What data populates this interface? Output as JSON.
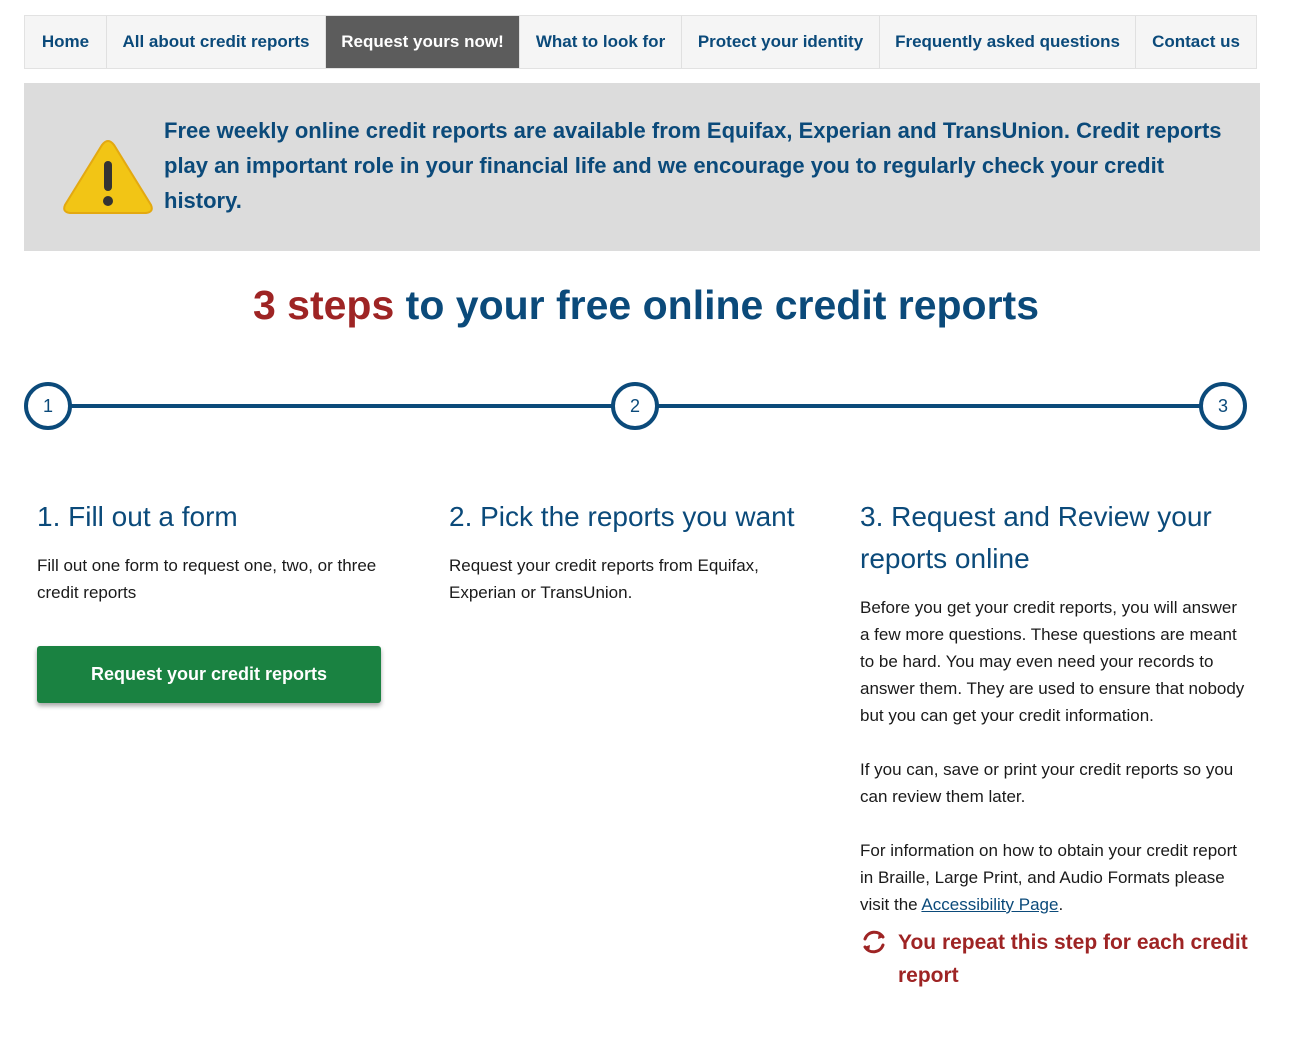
{
  "nav": {
    "items": [
      {
        "label": "Home",
        "active": false
      },
      {
        "label": "All about credit reports",
        "active": false
      },
      {
        "label": "Request yours now!",
        "active": true
      },
      {
        "label": "What to look for",
        "active": false
      },
      {
        "label": "Protect your identity",
        "active": false
      },
      {
        "label": "Frequently asked questions",
        "active": false
      },
      {
        "label": "Contact us",
        "active": false
      }
    ]
  },
  "alert": {
    "icon": "warning-icon",
    "text": "Free weekly online credit reports are available from Equifax, Experian and TransUnion. Credit reports play an important role in your financial life and we encourage you to regularly check your credit history."
  },
  "headline": {
    "highlight": "3 steps",
    "rest": " to your free online credit reports"
  },
  "stepper": {
    "steps": [
      "1",
      "2",
      "3"
    ]
  },
  "steps": [
    {
      "title": "1. Fill out a form",
      "body": "Fill out one form to request one, two, or three credit reports",
      "button_label": "Request your credit reports"
    },
    {
      "title": "2. Pick the reports you want",
      "body": "Request your credit reports from Equifax, Experian or TransUnion."
    },
    {
      "title": "3. Request and Review your reports online",
      "para1": "Before you get your credit reports, you will answer a few more questions. These questions are meant to be hard. You may even need your records to answer them. They are used to ensure that nobody but you can get your credit information.",
      "para2": "If you can, save or print your credit reports so you can review them later.",
      "para3_prefix": "For information on how to obtain your credit report in Braille, Large Print, and Audio Formats please visit the ",
      "para3_link": "Accessibility Page",
      "para3_suffix": ".",
      "repeat_icon": "refresh-icon",
      "repeat_text": "You repeat this step for each credit report"
    }
  ],
  "colors": {
    "navy": "#0b4a7a",
    "red": "#9e2424",
    "green": "#1a8241",
    "nav_active": "#5c5c5c",
    "alert_bg": "#dcdcdc",
    "warning_yellow": "#f2c515"
  }
}
